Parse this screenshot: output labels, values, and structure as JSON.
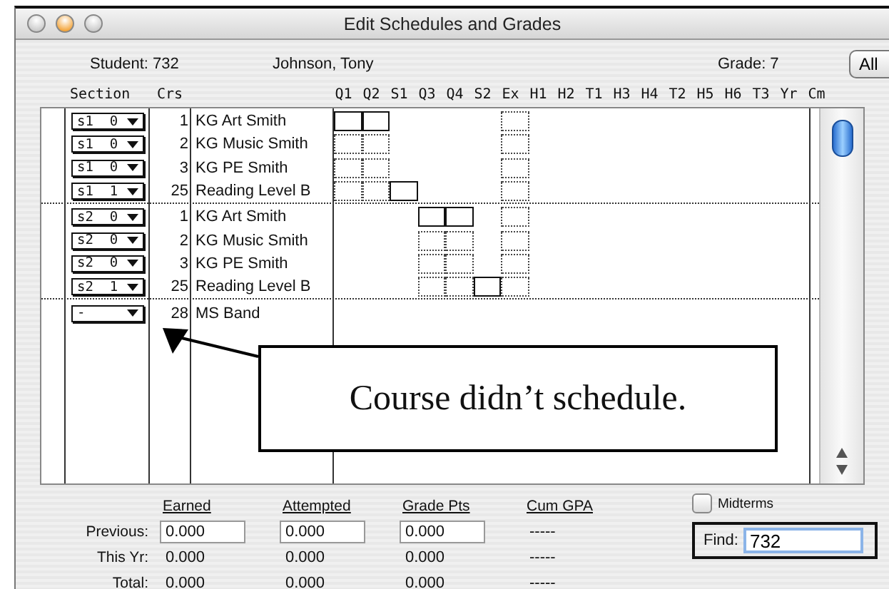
{
  "window": {
    "title": "Edit Schedules and Grades"
  },
  "student": {
    "label": "Student: 732",
    "name": "Johnson, Tony",
    "grade": "Grade: 7",
    "all_button": "All"
  },
  "columns": {
    "section": "Section",
    "crs": "Crs",
    "grades": [
      "Q1",
      "Q2",
      "S1",
      "Q3",
      "Q4",
      "S2",
      "Ex",
      "H1",
      "H2",
      "T1",
      "H3",
      "H4",
      "T2",
      "H5",
      "H6",
      "T3",
      "Yr",
      "Cm"
    ]
  },
  "groups": [
    {
      "rows": [
        {
          "section": "s1  0",
          "crs": "1",
          "course": "KG Art Smith",
          "cells": [
            {
              "kind": "solid"
            },
            {
              "kind": "solid"
            },
            {
              "kind": "empty"
            },
            {
              "kind": "empty"
            },
            {
              "kind": "empty"
            },
            {
              "kind": "empty"
            },
            {
              "kind": "dotted"
            }
          ]
        },
        {
          "section": "s1  0",
          "crs": "2",
          "course": "KG Music Smith",
          "cells": [
            {
              "kind": "dotted"
            },
            {
              "kind": "dotted"
            },
            {
              "kind": "empty"
            },
            {
              "kind": "empty"
            },
            {
              "kind": "empty"
            },
            {
              "kind": "empty"
            },
            {
              "kind": "dotted"
            }
          ]
        },
        {
          "section": "s1  0",
          "crs": "3",
          "course": "KG PE Smith",
          "cells": [
            {
              "kind": "dotted"
            },
            {
              "kind": "dotted"
            },
            {
              "kind": "empty"
            },
            {
              "kind": "empty"
            },
            {
              "kind": "empty"
            },
            {
              "kind": "empty"
            },
            {
              "kind": "dotted"
            }
          ]
        },
        {
          "section": "s1  1",
          "crs": "25",
          "course": "Reading Level B",
          "cells": [
            {
              "kind": "dotted"
            },
            {
              "kind": "dotted"
            },
            {
              "kind": "solid"
            },
            {
              "kind": "empty"
            },
            {
              "kind": "empty"
            },
            {
              "kind": "empty"
            },
            {
              "kind": "dotted"
            }
          ]
        }
      ]
    },
    {
      "rows": [
        {
          "section": "s2  0",
          "crs": "1",
          "course": "KG Art Smith",
          "cells": [
            {
              "kind": "empty"
            },
            {
              "kind": "empty"
            },
            {
              "kind": "empty"
            },
            {
              "kind": "solid"
            },
            {
              "kind": "solid"
            },
            {
              "kind": "empty"
            },
            {
              "kind": "dotted"
            }
          ]
        },
        {
          "section": "s2  0",
          "crs": "2",
          "course": "KG Music Smith",
          "cells": [
            {
              "kind": "empty"
            },
            {
              "kind": "empty"
            },
            {
              "kind": "empty"
            },
            {
              "kind": "dotted"
            },
            {
              "kind": "dotted"
            },
            {
              "kind": "empty"
            },
            {
              "kind": "dotted"
            }
          ]
        },
        {
          "section": "s2  0",
          "crs": "3",
          "course": "KG PE Smith",
          "cells": [
            {
              "kind": "empty"
            },
            {
              "kind": "empty"
            },
            {
              "kind": "empty"
            },
            {
              "kind": "dotted"
            },
            {
              "kind": "dotted"
            },
            {
              "kind": "empty"
            },
            {
              "kind": "dotted"
            }
          ]
        },
        {
          "section": "s2  1",
          "crs": "25",
          "course": "Reading Level B",
          "cells": [
            {
              "kind": "empty"
            },
            {
              "kind": "empty"
            },
            {
              "kind": "empty"
            },
            {
              "kind": "dotted"
            },
            {
              "kind": "dotted"
            },
            {
              "kind": "solid"
            },
            {
              "kind": "dotted"
            }
          ]
        }
      ]
    },
    {
      "rows": [
        {
          "section": "-",
          "crs": "28",
          "course": "MS Band"
        }
      ]
    }
  ],
  "annotation": {
    "text": "Course didn’t schedule."
  },
  "totals": {
    "headers": [
      "Earned",
      "Attempted",
      "Grade Pts",
      "Cum GPA"
    ],
    "rows": [
      {
        "label": "Previous:",
        "kind": "input",
        "values": [
          "0.000",
          "0.000",
          "0.000",
          "-----"
        ]
      },
      {
        "label": "This Yr:",
        "kind": "text",
        "values": [
          "0.000",
          "0.000",
          "0.000",
          "-----"
        ]
      },
      {
        "label": "Total:",
        "kind": "text",
        "values": [
          "0.000",
          "0.000",
          "0.000",
          "-----"
        ]
      }
    ]
  },
  "midterms": {
    "label": "Midterms",
    "checked": false
  },
  "find": {
    "label": "Find:",
    "value": "732"
  }
}
